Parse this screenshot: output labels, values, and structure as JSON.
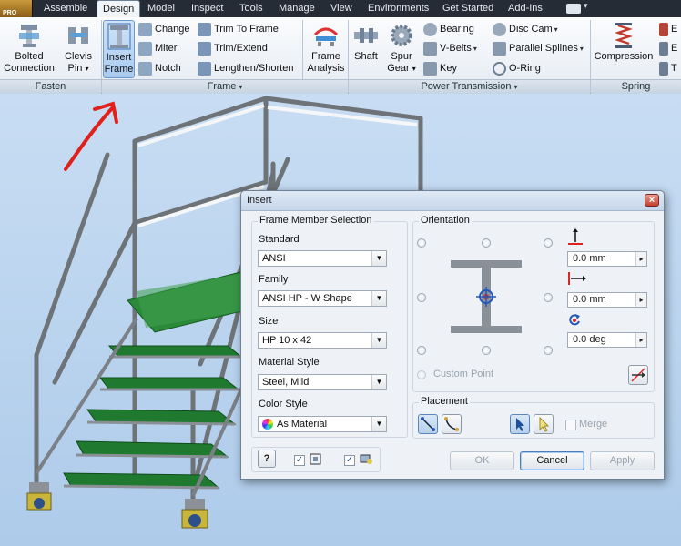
{
  "ribbon": {
    "tabs": [
      "Assemble",
      "Design",
      "Model",
      "Inspect",
      "Tools",
      "Manage",
      "View",
      "Environments",
      "Get Started",
      "Add-Ins"
    ],
    "active_tab": "Design",
    "app_badge": "PRO",
    "groups": {
      "fasten": "Fasten",
      "frame": "Frame",
      "power_transmission": "Power Transmission",
      "spring": "Spring"
    },
    "buttons": {
      "bolted_connection": [
        "Bolted",
        "Connection"
      ],
      "clevis_pin": [
        "Clevis",
        "Pin"
      ],
      "insert_frame": [
        "Insert",
        "Frame"
      ],
      "change": "Change",
      "miter": "Miter",
      "notch": "Notch",
      "trim_to_frame": "Trim To Frame",
      "trim_extend": "Trim/Extend",
      "lengthen_shorten": "Lengthen/Shorten",
      "frame_analysis": [
        "Frame",
        "Analysis"
      ],
      "shaft": "Shaft",
      "spur_gear": [
        "Spur",
        "Gear"
      ],
      "bearing": "Bearing",
      "v_belts": "V-Belts",
      "key": "Key",
      "disc_cam": "Disc Cam",
      "parallel_splines": "Parallel Splines",
      "o_ring": "O-Ring",
      "compression": "Compression",
      "spring_cut_1": "E",
      "spring_cut_2": "E",
      "spring_cut_3": "T"
    }
  },
  "dialog": {
    "title": "Insert",
    "frame_member_selection": {
      "legend": "Frame Member Selection",
      "standard_label": "Standard",
      "standard_value": "ANSI",
      "family_label": "Family",
      "family_value": "ANSI HP - W Shape",
      "size_label": "Size",
      "size_value": "HP 10 x 42",
      "material_label": "Material Style",
      "material_value": "Steel, Mild",
      "color_label": "Color Style",
      "color_value": "As Material"
    },
    "orientation": {
      "legend": "Orientation",
      "vertical_offset": "0.0 mm",
      "horizontal_offset": "0.0 mm",
      "rotation": "0.0 deg",
      "custom_point": "Custom Point"
    },
    "placement": {
      "legend": "Placement",
      "merge_label": "Merge"
    },
    "buttons": {
      "ok": "OK",
      "cancel": "Cancel",
      "apply": "Apply",
      "help": "?"
    }
  },
  "colors": {
    "ribbon_bg": "#eef3f8",
    "tabbar_bg": "#252c36",
    "viewport_bg": "#bcd6f0",
    "tread_green": "#1f7a2f",
    "annotation_red": "#e0201a"
  }
}
